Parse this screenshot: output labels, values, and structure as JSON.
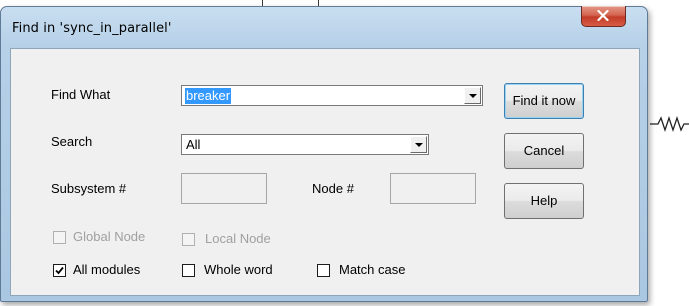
{
  "dialog": {
    "title": "Find in 'sync_in_parallel'",
    "close_icon": "close-x-icon"
  },
  "form": {
    "find_what": {
      "label": "Find What",
      "value": "breaker"
    },
    "search": {
      "label": "Search",
      "value": "All"
    },
    "subsystem": {
      "label": "Subsystem #",
      "value": ""
    },
    "node": {
      "label": "Node #",
      "value": ""
    }
  },
  "options": {
    "global_node": {
      "label": "Global Node",
      "checked": false,
      "enabled": false
    },
    "local_node": {
      "label": "Local Node",
      "checked": false,
      "enabled": false
    },
    "all_modules": {
      "label": "All modules",
      "checked": true,
      "enabled": true
    },
    "whole_word": {
      "label": "Whole word",
      "checked": false,
      "enabled": true
    },
    "match_case": {
      "label": "Match case",
      "checked": false,
      "enabled": true
    }
  },
  "buttons": {
    "find_now": "Find it now",
    "cancel": "Cancel",
    "help": "Help"
  },
  "colors": {
    "selection": "#3399ff",
    "close_button": "#c94a36",
    "title_bar": "#b9d1ea"
  }
}
